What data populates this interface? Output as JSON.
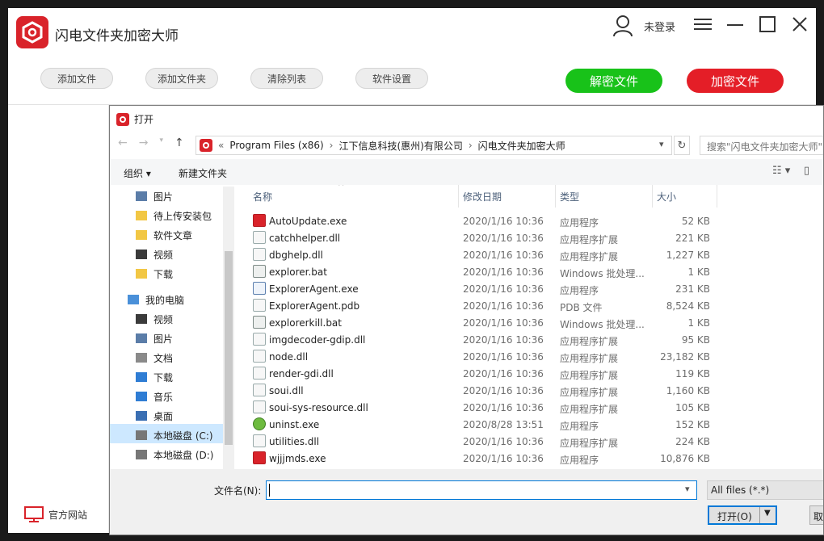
{
  "app": {
    "title": "闪电文件夹加密大师",
    "user_label": "未登录",
    "brand_color": "#d9232a",
    "accent_green": "#18c219",
    "accent_red": "#e41e27"
  },
  "toolbar": {
    "add_file": "添加文件",
    "add_folder": "添加文件夹",
    "clear_list": "清除列表",
    "settings": "软件设置",
    "decrypt": "解密文件",
    "encrypt": "加密文件"
  },
  "footer": {
    "official_site": "官方网站"
  },
  "dialog": {
    "title": "打开",
    "breadcrumb": {
      "prefix": "«",
      "parts": [
        "Program Files (x86)",
        "江下信息科技(惠州)有限公司",
        "闪电文件夹加密大师"
      ],
      "sep": "›"
    },
    "search_placeholder": "搜索\"闪电文件夹加密大师\"",
    "organize": "组织 ▾",
    "new_folder": "新建文件夹",
    "nav": [
      {
        "label": "图片",
        "icon": "pictures-icon"
      },
      {
        "label": "待上传安装包",
        "icon": "folder-icon"
      },
      {
        "label": "软件文章",
        "icon": "folder-icon"
      },
      {
        "label": "视频",
        "icon": "video-icon"
      },
      {
        "label": "下载",
        "icon": "folder-icon"
      },
      {
        "label": "我的电脑",
        "icon": "computer-icon"
      },
      {
        "label": "视频",
        "icon": "video-icon"
      },
      {
        "label": "图片",
        "icon": "pictures-icon"
      },
      {
        "label": "文档",
        "icon": "documents-icon"
      },
      {
        "label": "下载",
        "icon": "download-icon"
      },
      {
        "label": "音乐",
        "icon": "music-icon"
      },
      {
        "label": "桌面",
        "icon": "desktop-icon"
      },
      {
        "label": "本地磁盘 (C:)",
        "icon": "disk-icon"
      },
      {
        "label": "本地磁盘 (D:)",
        "icon": "disk-icon"
      }
    ],
    "columns": {
      "name": "名称",
      "date": "修改日期",
      "type": "类型",
      "size": "大小"
    },
    "files": [
      {
        "name": "AutoUpdate.exe",
        "date": "2020/1/16 10:36",
        "type": "应用程序",
        "size": "52 KB",
        "icon": "app"
      },
      {
        "name": "catchhelper.dll",
        "date": "2020/1/16 10:36",
        "type": "应用程序扩展",
        "size": "221 KB",
        "icon": "dll"
      },
      {
        "name": "dbghelp.dll",
        "date": "2020/1/16 10:36",
        "type": "应用程序扩展",
        "size": "1,227 KB",
        "icon": "dll"
      },
      {
        "name": "explorer.bat",
        "date": "2020/1/16 10:36",
        "type": "Windows 批处理...",
        "size": "1 KB",
        "icon": "bat"
      },
      {
        "name": "ExplorerAgent.exe",
        "date": "2020/1/16 10:36",
        "type": "应用程序",
        "size": "231 KB",
        "icon": "exe"
      },
      {
        "name": "ExplorerAgent.pdb",
        "date": "2020/1/16 10:36",
        "type": "PDB 文件",
        "size": "8,524 KB",
        "icon": "file"
      },
      {
        "name": "explorerkill.bat",
        "date": "2020/1/16 10:36",
        "type": "Windows 批处理...",
        "size": "1 KB",
        "icon": "bat"
      },
      {
        "name": "imgdecoder-gdip.dll",
        "date": "2020/1/16 10:36",
        "type": "应用程序扩展",
        "size": "95 KB",
        "icon": "dll"
      },
      {
        "name": "node.dll",
        "date": "2020/1/16 10:36",
        "type": "应用程序扩展",
        "size": "23,182 KB",
        "icon": "dll"
      },
      {
        "name": "render-gdi.dll",
        "date": "2020/1/16 10:36",
        "type": "应用程序扩展",
        "size": "119 KB",
        "icon": "dll"
      },
      {
        "name": "soui.dll",
        "date": "2020/1/16 10:36",
        "type": "应用程序扩展",
        "size": "1,160 KB",
        "icon": "dll"
      },
      {
        "name": "soui-sys-resource.dll",
        "date": "2020/1/16 10:36",
        "type": "应用程序扩展",
        "size": "105 KB",
        "icon": "dll"
      },
      {
        "name": "uninst.exe",
        "date": "2020/8/28 13:51",
        "type": "应用程序",
        "size": "152 KB",
        "icon": "uninst"
      },
      {
        "name": "utilities.dll",
        "date": "2020/1/16 10:36",
        "type": "应用程序扩展",
        "size": "224 KB",
        "icon": "dll"
      },
      {
        "name": "wjjjmds.exe",
        "date": "2020/1/16 10:36",
        "type": "应用程序",
        "size": "10,876 KB",
        "icon": "app"
      }
    ],
    "filename_label": "文件名(N):",
    "filename_value": "",
    "filter": "All files (*.*)",
    "open": "打开(O)",
    "cancel": "取消"
  }
}
